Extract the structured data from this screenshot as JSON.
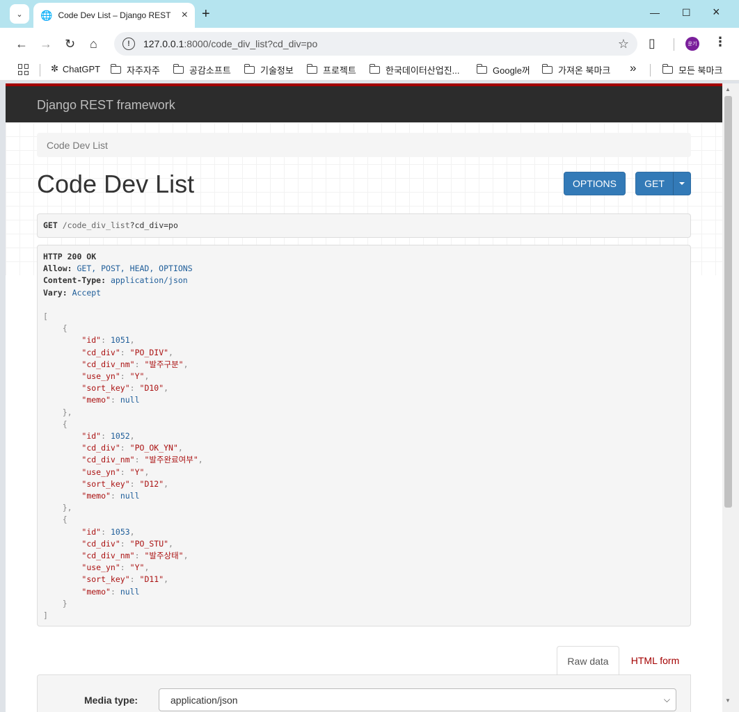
{
  "browser": {
    "tab_title": "Code Dev List – Django REST f",
    "url_host": "127.0.0.1",
    "url_rest": ":8000/code_div_list?cd_div=po",
    "profile_initials": "윤기",
    "bookmarks": [
      "ChatGPT",
      "자주자주",
      "공감소프트",
      "기술정보",
      "프로젝트",
      "한국데이터산업진...",
      "Google꺼",
      "가져온 북마크",
      "모든 북마크"
    ]
  },
  "navbar": {
    "brand": "Django REST framework"
  },
  "breadcrumb": "Code Dev List",
  "page_title": "Code Dev List",
  "buttons": {
    "options": "OPTIONS",
    "get": "GET"
  },
  "request": {
    "method": "GET",
    "path": "/code_div_list",
    "query": "?cd_div=po"
  },
  "response": {
    "status": "HTTP 200 OK",
    "headers": [
      {
        "name": "Allow:",
        "value": "GET, POST, HEAD, OPTIONS"
      },
      {
        "name": "Content-Type:",
        "value": "application/json"
      },
      {
        "name": "Vary:",
        "value": "Accept"
      }
    ],
    "items": [
      {
        "id": "1051",
        "cd_div": "\"PO_DIV\"",
        "cd_div_nm": "\"발주구분\"",
        "use_yn": "\"Y\"",
        "sort_key": "\"D10\"",
        "memo": "null"
      },
      {
        "id": "1052",
        "cd_div": "\"PO_OK_YN\"",
        "cd_div_nm": "\"발주완료여부\"",
        "use_yn": "\"Y\"",
        "sort_key": "\"D12\"",
        "memo": "null"
      },
      {
        "id": "1053",
        "cd_div": "\"PO_STU\"",
        "cd_div_nm": "\"발주상태\"",
        "use_yn": "\"Y\"",
        "sort_key": "\"D11\"",
        "memo": "null"
      }
    ]
  },
  "form_tabs": {
    "raw": "Raw data",
    "html": "HTML form"
  },
  "media": {
    "label": "Media type:",
    "value": "application/json"
  },
  "colors": {
    "brand_red": "#a30000",
    "button_blue": "#337ab7",
    "navbar": "#2c2c2c"
  }
}
